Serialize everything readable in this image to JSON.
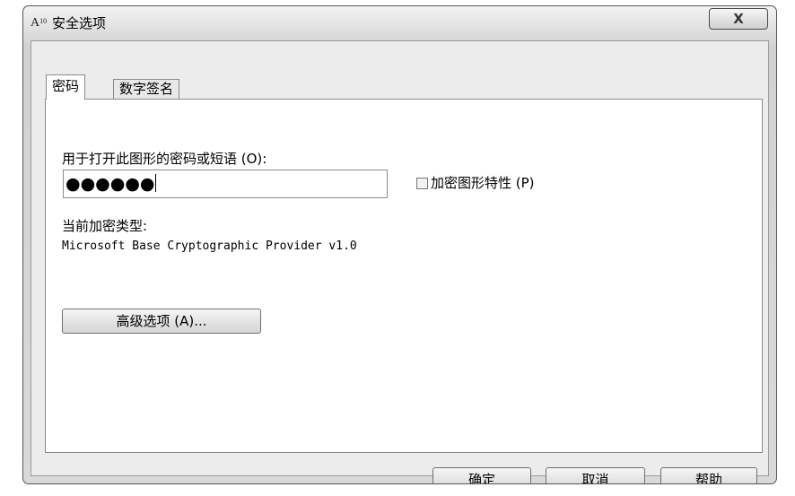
{
  "window": {
    "title": "安全选项",
    "app_icon_text": "A",
    "app_icon_sub": "10",
    "close_glyph": "X"
  },
  "tabs": [
    {
      "label": "密码",
      "active": true
    },
    {
      "label": "数字签名",
      "active": false
    }
  ],
  "password_panel": {
    "password_label": "用于打开此图形的密码或短语 (O):",
    "password_value": "●●●●●●",
    "encrypt_props_label": "加密图形特性 (P)",
    "encrypt_props_checked": false,
    "encryption_type_label": "当前加密类型:",
    "encryption_type_value": "Microsoft Base Cryptographic Provider v1.0",
    "advanced_button": "高级选项 (A)..."
  },
  "footer": {
    "ok": "确定",
    "cancel": "取消",
    "help": "帮助"
  }
}
